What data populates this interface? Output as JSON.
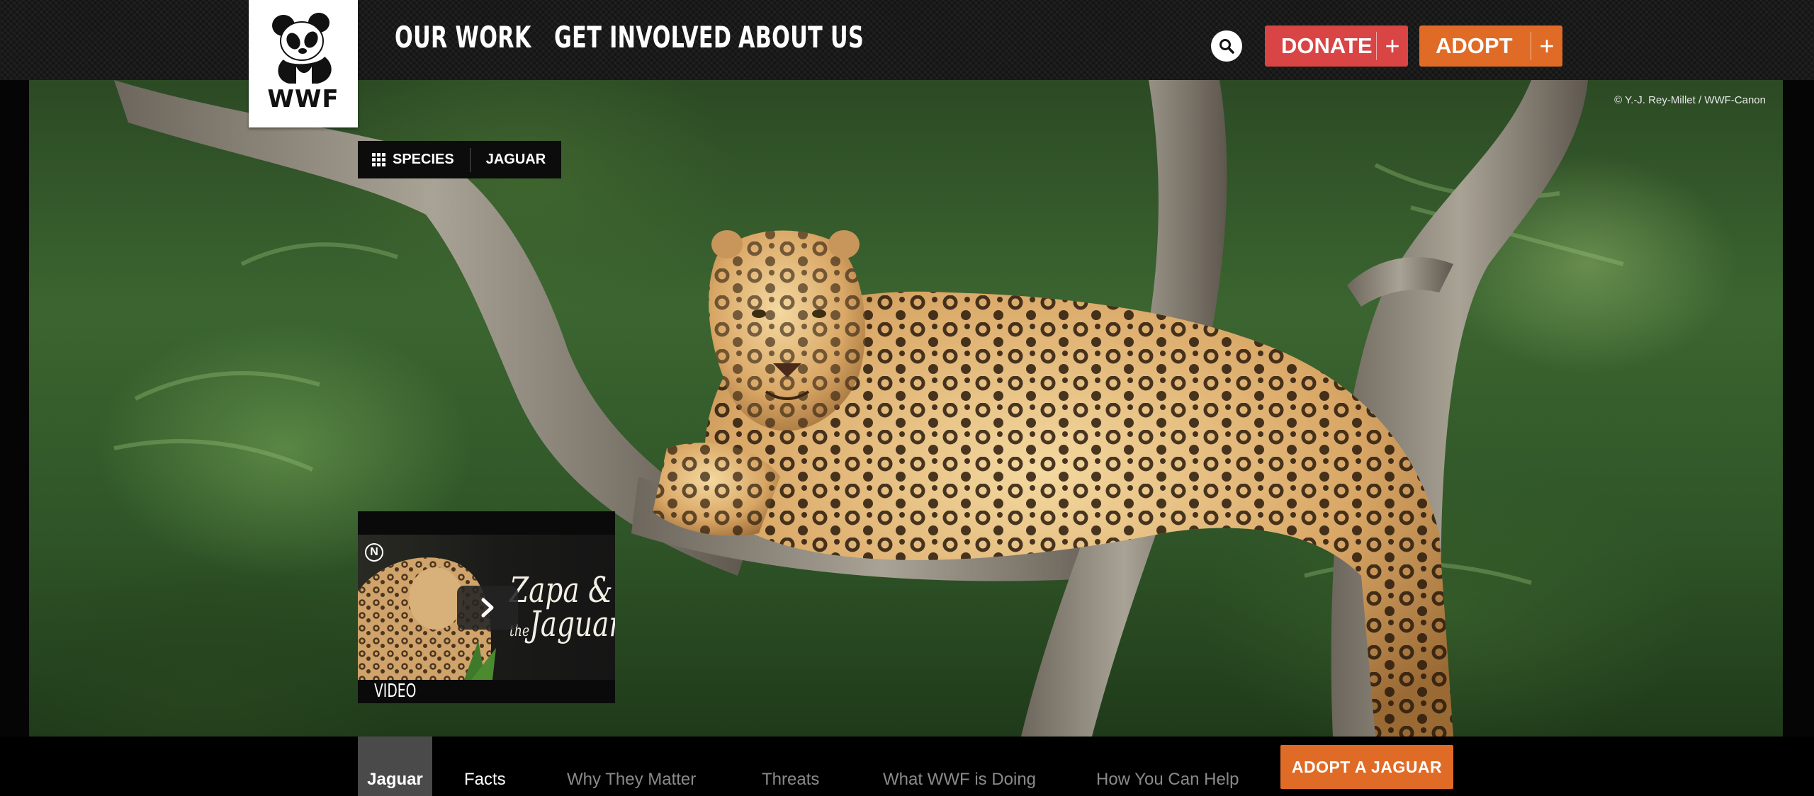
{
  "header": {
    "logo_text": "WWF",
    "nav": [
      "OUR WORK",
      "GET INVOLVED",
      "ABOUT US"
    ],
    "donate_label": "DONATE",
    "adopt_label": "ADOPT",
    "plus_symbol": "+"
  },
  "hero": {
    "photo_credit": "© Y.-J. Rey-Millet / WWF-Canon",
    "breadcrumb": {
      "section": "SPECIES",
      "current": "JAGUAR"
    },
    "video": {
      "title_line1": "Zapa &",
      "title_small": "the",
      "title_line2": "Jaguar",
      "label": "VIDEO",
      "channel_mark": "N"
    }
  },
  "subnav": {
    "tabs": [
      "Jaguar",
      "Facts",
      "Why They Matter",
      "Threats",
      "What WWF is Doing",
      "How You Can Help"
    ],
    "active_tab": "Jaguar",
    "cta_label": "ADOPT A JAGUAR"
  },
  "colors": {
    "donate": "#d94445",
    "adopt": "#e06b26",
    "header_bg": "#151515",
    "active_tab_bg": "#4a4a4a"
  }
}
